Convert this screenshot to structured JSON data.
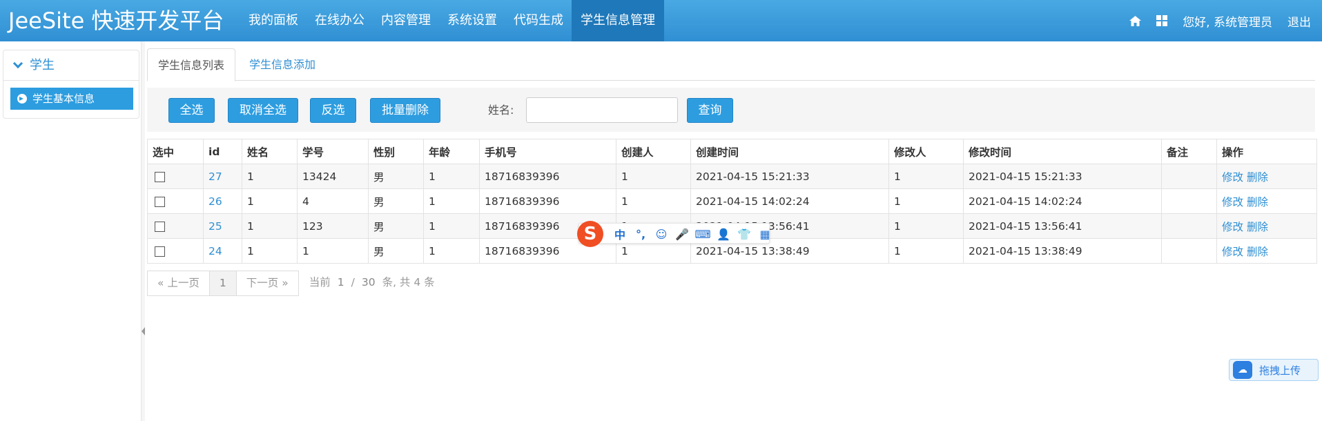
{
  "brand": {
    "title": "JeeSite 快速开发平台"
  },
  "nav": {
    "items": [
      "我的面板",
      "在线办公",
      "内容管理",
      "系统设置",
      "代码生成",
      "学生信息管理"
    ],
    "active_index": 5
  },
  "user_nav": {
    "greeting": "您好, 系统管理员",
    "logout": "退出"
  },
  "sidebar": {
    "section_title": "学生",
    "items": [
      {
        "label": "学生基本信息"
      }
    ]
  },
  "tabs": [
    "学生信息列表",
    "学生信息添加"
  ],
  "toolbar": {
    "select_all": "全选",
    "deselect_all": "取消全选",
    "invert": "反选",
    "batch_delete": "批量删除",
    "name_label": "姓名:",
    "name_value": "",
    "query": "查询"
  },
  "table": {
    "headers": [
      "选中",
      "id",
      "姓名",
      "学号",
      "性别",
      "年龄",
      "手机号",
      "创建人",
      "创建时间",
      "修改人",
      "修改时间",
      "备注",
      "操作"
    ],
    "rows": [
      {
        "id": "27",
        "name": "1",
        "sno": "13424",
        "gender": "男",
        "age": "1",
        "phone": "18716839396",
        "creator": "1",
        "created": "2021-04-15 15:21:33",
        "modifier": "1",
        "modified": "2021-04-15 15:21:33",
        "remark": ""
      },
      {
        "id": "26",
        "name": "1",
        "sno": "4",
        "gender": "男",
        "age": "1",
        "phone": "18716839396",
        "creator": "1",
        "created": "2021-04-15 14:02:24",
        "modifier": "1",
        "modified": "2021-04-15 14:02:24",
        "remark": ""
      },
      {
        "id": "25",
        "name": "1",
        "sno": "123",
        "gender": "男",
        "age": "1",
        "phone": "18716839396",
        "creator": "1",
        "created": "2021-04-15 13:56:41",
        "modifier": "1",
        "modified": "2021-04-15 13:56:41",
        "remark": ""
      },
      {
        "id": "24",
        "name": "1",
        "sno": "1",
        "gender": "男",
        "age": "1",
        "phone": "18716839396",
        "creator": "1",
        "created": "2021-04-15 13:38:49",
        "modifier": "1",
        "modified": "2021-04-15 13:38:49",
        "remark": ""
      }
    ],
    "actions": {
      "edit": "修改",
      "delete": "删除"
    }
  },
  "pager": {
    "prev": "« 上一页",
    "current_page": "1",
    "next": "下一页 »",
    "current_label": "当前",
    "page_input": "1",
    "sep": "/",
    "page_size": "30",
    "total_text": "条, 共 4 条"
  },
  "ime_toolbar": {
    "logo": "S",
    "items": [
      "中",
      "°,",
      "☺",
      "🎤",
      "⌨",
      "👤",
      "👕",
      "▦"
    ]
  },
  "upload_widget": {
    "label": "拖拽上传"
  },
  "colors": {
    "navbar": "#2f8fd3",
    "nav_active": "#1f78b9",
    "button": "#2d9de0",
    "link": "#2f8fd3"
  }
}
